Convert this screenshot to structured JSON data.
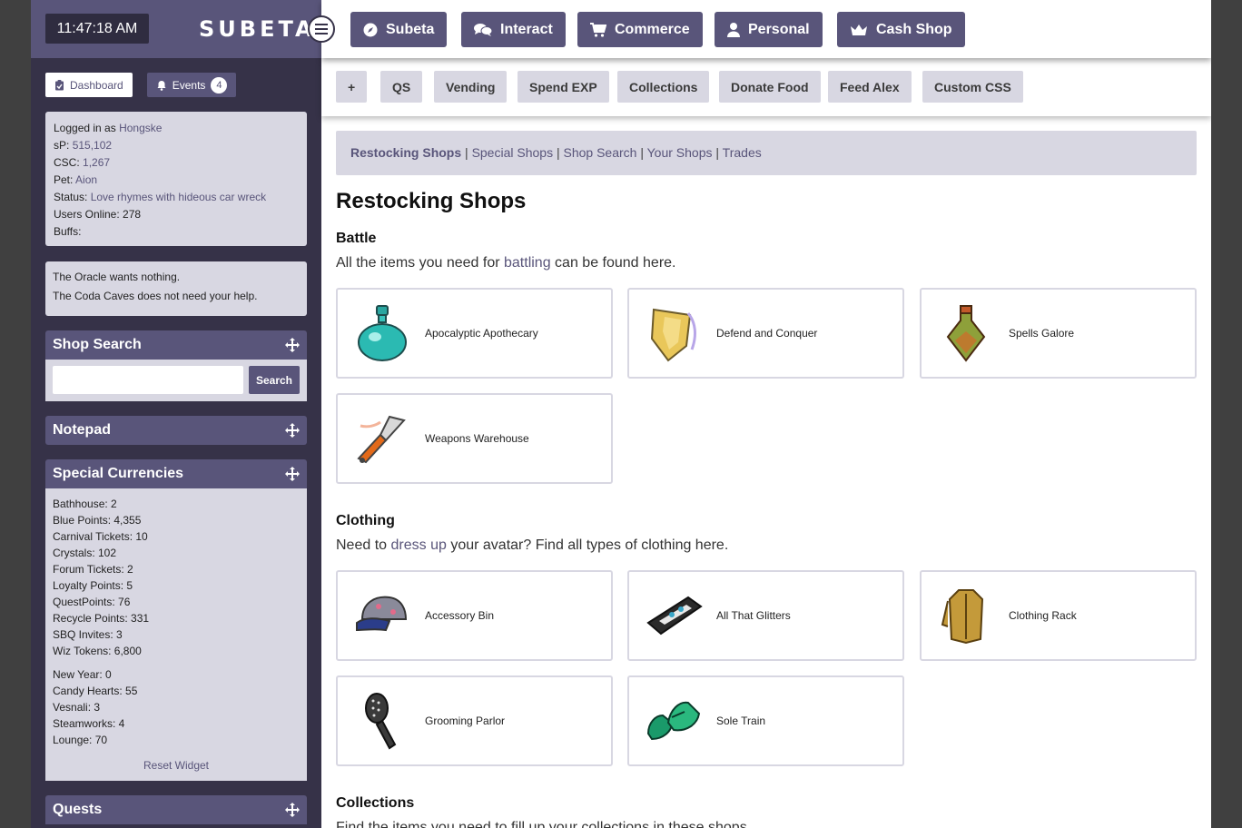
{
  "clock": "11:47:18 AM",
  "logo": "SUBETA",
  "topnav": [
    {
      "label": "Subeta",
      "icon": "compass-icon"
    },
    {
      "label": "Interact",
      "icon": "chat-icon"
    },
    {
      "label": "Commerce",
      "icon": "cart-icon"
    },
    {
      "label": "Personal",
      "icon": "user-icon"
    },
    {
      "label": "Cash Shop",
      "icon": "crown-icon"
    }
  ],
  "subnav": [
    "+",
    "QS",
    "Vending",
    "Spend EXP",
    "Collections",
    "Donate Food",
    "Feed Alex",
    "Custom CSS"
  ],
  "sidebar": {
    "dashboard": "Dashboard",
    "events": "Events",
    "events_count": "4",
    "user": {
      "logged_label": "Logged in as",
      "username": "Hongske",
      "sp_label": "sP:",
      "sp": "515,102",
      "csc_label": "CSC:",
      "csc": "1,267",
      "pet_label": "Pet:",
      "pet": "Aion",
      "status_label": "Status:",
      "status": "Love rhymes with hideous car wreck",
      "online": "Users Online: 278",
      "buffs": "Buffs:"
    },
    "oracle": "The Oracle wants nothing.",
    "coda": "The Coda Caves does not need your help.",
    "shop_search_title": "Shop Search",
    "search_button": "Search",
    "search_value": "",
    "notepad_title": "Notepad",
    "currencies_title": "Special Currencies",
    "currencies_a": [
      "Bathhouse: 2",
      "Blue Points: 4,355",
      "Carnival Tickets: 10",
      "Crystals: 102",
      "Forum Tickets: 2",
      "Loyalty Points: 5",
      "QuestPoints: 76",
      "Recycle Points: 331",
      "SBQ Invites: 3",
      "Wiz Tokens: 6,800"
    ],
    "currencies_b": [
      "New Year: 0",
      "Candy Hearts: 55",
      "Vesnali: 3",
      "Steamworks: 4",
      "Lounge: 70"
    ],
    "reset": "Reset Widget",
    "quests_title": "Quests"
  },
  "breadcrumb": {
    "current": "Restocking Shops",
    "links": [
      "Special Shops",
      "Shop Search",
      "Your Shops",
      "Trades"
    ],
    "sep": "|"
  },
  "page_title": "Restocking Shops",
  "battle": {
    "title": "Battle",
    "desc_pre": "All the items you need for",
    "desc_link": "battling",
    "desc_post": "can be found here.",
    "shops": [
      "Apocalyptic Apothecary",
      "Defend and Conquer",
      "Spells Galore",
      "Weapons Warehouse"
    ]
  },
  "clothing": {
    "title": "Clothing",
    "desc_pre": "Need to",
    "desc_link": "dress up",
    "desc_post": "your avatar? Find all types of clothing here.",
    "shops": [
      "Accessory Bin",
      "All That Glitters",
      "Clothing Rack",
      "Grooming Parlor",
      "Sole Train"
    ]
  },
  "collections": {
    "title": "Collections",
    "desc": "Find the items you need to fill up your collections in these shops."
  },
  "colors": {
    "accent": "#59557a",
    "panel": "#d8d7e2",
    "sidebar": "#363248"
  }
}
